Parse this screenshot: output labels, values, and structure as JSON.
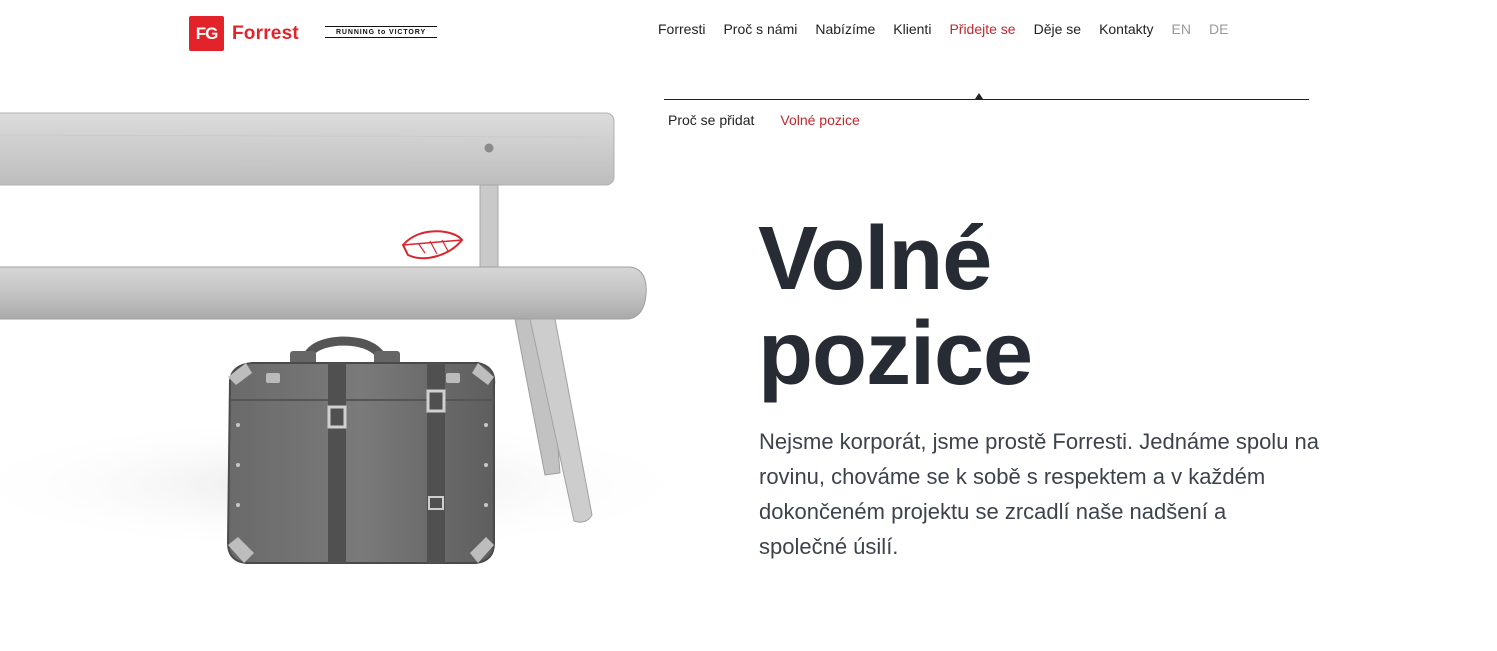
{
  "header": {
    "logo_badge": "FG",
    "logo_word": "Forrest",
    "tagline": "RUNNING to VICTORY"
  },
  "nav": {
    "items": [
      {
        "label": "Forresti"
      },
      {
        "label": "Proč s námi"
      },
      {
        "label": "Nabízíme"
      },
      {
        "label": "Klienti"
      },
      {
        "label": "Přidejte se",
        "active": true
      },
      {
        "label": "Děje se"
      },
      {
        "label": "Kontakty"
      }
    ],
    "languages": [
      "EN",
      "DE"
    ]
  },
  "subnav": {
    "items": [
      {
        "label": "Proč se přidat"
      },
      {
        "label": "Volné pozice",
        "active": true
      }
    ]
  },
  "hero": {
    "title_line1": "Volné",
    "title_line2": "pozice",
    "text": "Nejsme korporát, jsme prostě Forresti. Jednáme spolu na rovinu, chováme se k sobě s respektem a v každém dokončeném projektu se zrcadlí naše nadšení a společné úsilí."
  },
  "colors": {
    "brand_red": "#e3232a",
    "active_red": "#c1272d",
    "title_dark": "#272b34"
  }
}
